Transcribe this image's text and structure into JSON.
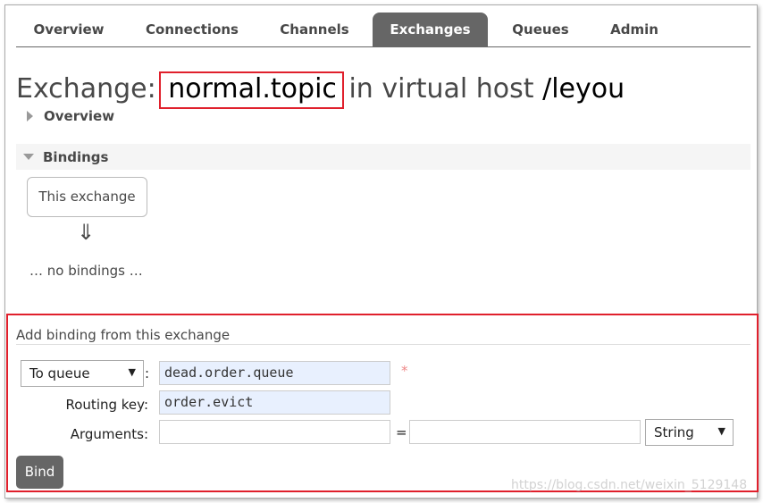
{
  "nav": {
    "tabs": [
      {
        "label": "Overview",
        "active": false
      },
      {
        "label": "Connections",
        "active": false
      },
      {
        "label": "Channels",
        "active": false
      },
      {
        "label": "Exchanges",
        "active": true
      },
      {
        "label": "Queues",
        "active": false
      },
      {
        "label": "Admin",
        "active": false
      }
    ]
  },
  "page": {
    "title_prefix": "Exchange:",
    "exchange_name": "normal.topic",
    "title_middle": "in virtual host",
    "vhost": "/leyou"
  },
  "sections": {
    "overview": "Overview",
    "bindings": "Bindings"
  },
  "bindings": {
    "this_exchange": "This exchange",
    "arrow": "⇓",
    "empty": "… no bindings …"
  },
  "add_binding": {
    "heading": "Add binding from this exchange",
    "destination_type": "To queue",
    "colon": ":",
    "destination_value": "dead.order.queue",
    "required_mark": "*",
    "routing_key_label": "Routing key:",
    "routing_key_value": "order.evict",
    "arguments_label": "Arguments:",
    "argument_key": "",
    "equals": "=",
    "argument_value": "",
    "argument_type": "String",
    "bind_label": "Bind"
  },
  "watermark": "https://blog.csdn.net/weixin_5129148",
  "colors": {
    "active_tab": "#666666",
    "highlight_box": "#e0202c",
    "filled_input": "#e8f0fe"
  }
}
